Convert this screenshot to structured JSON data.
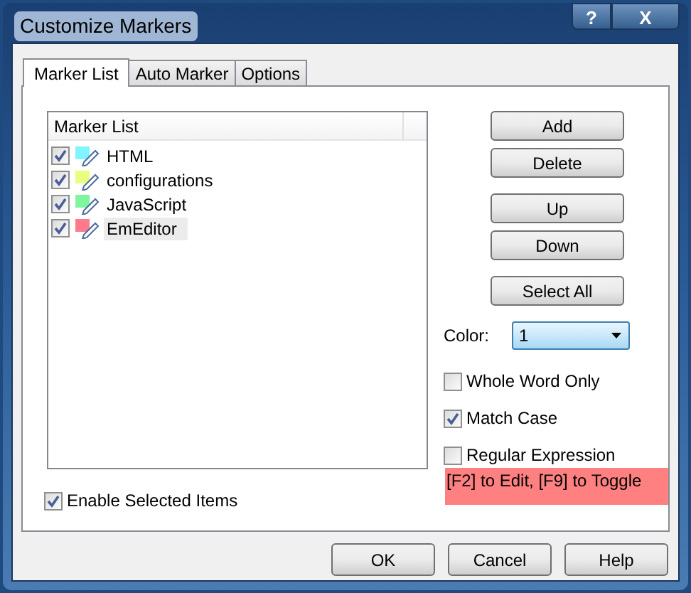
{
  "window": {
    "title": "Customize Markers",
    "help": "?",
    "close": "X"
  },
  "tabs": [
    {
      "label": "Marker List",
      "selected": true
    },
    {
      "label": "Auto Marker",
      "selected": false
    },
    {
      "label": "Options",
      "selected": false
    }
  ],
  "marker_list": {
    "column": "Marker List",
    "items": [
      {
        "name": "HTML",
        "checked": true,
        "color": "#80f4ff",
        "selected": false
      },
      {
        "name": "configurations",
        "checked": true,
        "color": "#e8ff80",
        "selected": false
      },
      {
        "name": "JavaScript",
        "checked": true,
        "color": "#80f5a0",
        "selected": false
      },
      {
        "name": "EmEditor",
        "checked": true,
        "color": "#ff7a8a",
        "selected": true
      }
    ]
  },
  "side_buttons": [
    [
      "Add",
      "Delete"
    ],
    [
      "Up",
      "Down"
    ],
    [
      "Select All"
    ]
  ],
  "color": {
    "label": "Color:",
    "value": "1"
  },
  "options": [
    {
      "label": "Whole Word Only",
      "checked": false
    },
    {
      "label": "Match Case",
      "checked": true
    },
    {
      "label": "Regular Expression",
      "checked": false
    }
  ],
  "hint": "[F2] to Edit, [F9] to Toggle",
  "enable_selected": {
    "label": "Enable Selected Items",
    "checked": true
  },
  "footer_buttons": [
    "OK",
    "Cancel",
    "Help"
  ]
}
